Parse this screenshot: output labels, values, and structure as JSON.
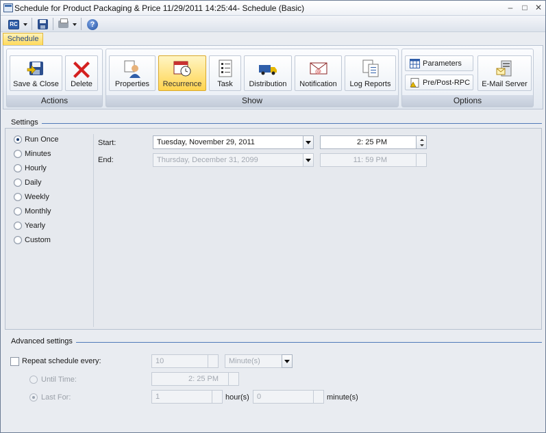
{
  "window": {
    "title": "Schedule for Product Packaging & Price 11/29/2011 14:25:44- Schedule (Basic)",
    "controls": {
      "minimize": "–",
      "maximize": "□",
      "close": "✕"
    }
  },
  "quick_access": {
    "rc_label": "RC",
    "items": [
      "rc-menu",
      "save",
      "print",
      "help"
    ]
  },
  "ribbon": {
    "tab": "Schedule",
    "groups": {
      "actions": {
        "label": "Actions",
        "save_close": "Save & Close",
        "delete": "Delete"
      },
      "show": {
        "label": "Show",
        "properties": "Properties",
        "recurrence": "Recurrence",
        "task": "Task",
        "distribution": "Distribution",
        "notification": "Notification",
        "log_reports": "Log Reports"
      },
      "options": {
        "label": "Options",
        "parameters": "Parameters",
        "pre_post_rpc": "Pre/Post-RPC",
        "email_server": "E-Mail Server"
      }
    },
    "active_button": "Recurrence",
    "active_color": "#ffd44f"
  },
  "settings": {
    "title": "Settings",
    "frequencies": [
      "Run Once",
      "Minutes",
      "Hourly",
      "Daily",
      "Weekly",
      "Monthly",
      "Yearly",
      "Custom"
    ],
    "selected": "Run Once",
    "start_label": "Start:",
    "start_date": "Tuesday, November 29, 2011",
    "start_time": "2: 25 PM",
    "end_label": "End:",
    "end_date": "Thursday, December 31, 2099",
    "end_time": "11: 59 PM"
  },
  "advanced": {
    "title": "Advanced settings",
    "repeat_label": "Repeat schedule every:",
    "repeat_value": "10",
    "repeat_unit": "Minute(s)",
    "until_time_label": "Until Time:",
    "until_time_value": "2: 25 PM",
    "last_for_label": "Last For:",
    "last_for_hours": "1",
    "hours_label": "hour(s)",
    "last_for_minutes": "0",
    "minutes_label": "minute(s)"
  }
}
